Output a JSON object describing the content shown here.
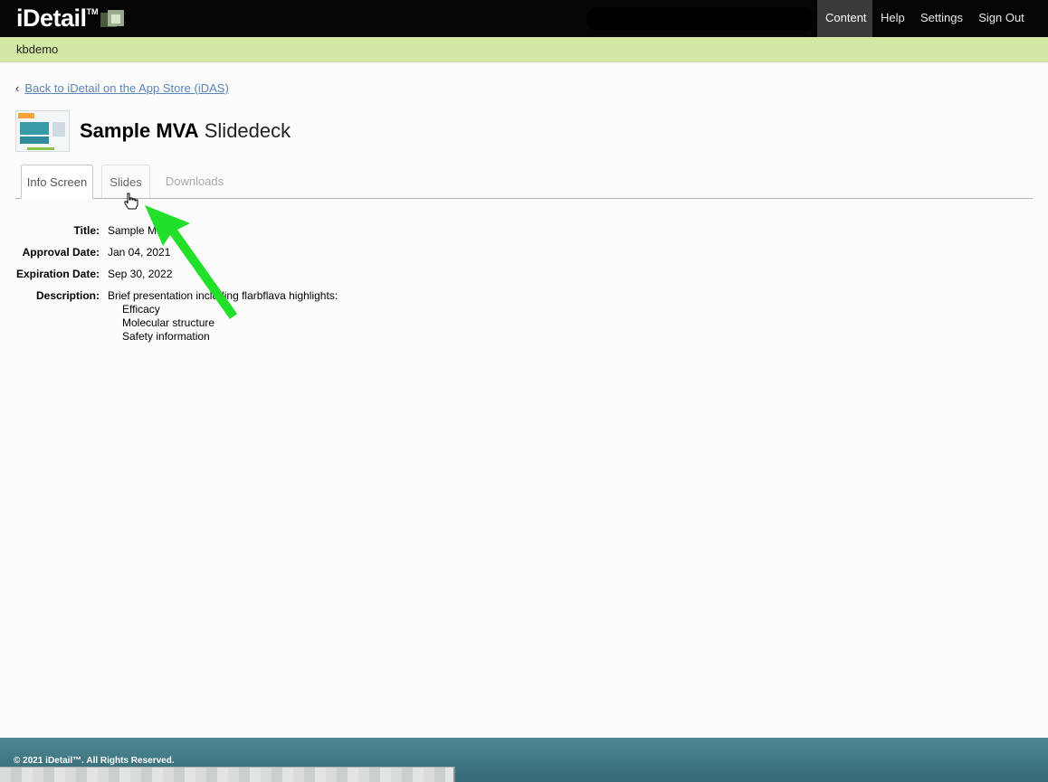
{
  "topbar": {
    "logo": "iDetail",
    "logo_tm": "TM",
    "nav": [
      {
        "label": "Content",
        "active": true
      },
      {
        "label": "Help",
        "active": false
      },
      {
        "label": "Settings",
        "active": false
      },
      {
        "label": "Sign Out",
        "active": false
      }
    ]
  },
  "userbar": {
    "username": "kbdemo"
  },
  "back": {
    "chevron": "‹",
    "label": "Back to iDetail on the App Store (iDAS)"
  },
  "header": {
    "title_bold": "Sample MVA",
    "title_light": "Slidedeck"
  },
  "tabs": [
    {
      "label": "Info Screen",
      "active": true
    },
    {
      "label": "Slides",
      "active": false
    },
    {
      "label": "Downloads",
      "disabled": true
    }
  ],
  "info": {
    "title_label": "Title:",
    "title_value": "Sample M",
    "approval_label": "Approval Date:",
    "approval_value": "Jan 04, 2021",
    "expiration_label": "Expiration Date:",
    "expiration_value": "Sep 30, 2022",
    "description_label": "Description:",
    "description_value": "Brief presentation including flarbflava highlights:",
    "description_items": [
      "Efficacy",
      "Molecular structure",
      "Safety information"
    ]
  },
  "footer": {
    "copyright": "© 2021 iDetail™.  All Rights Reserved."
  },
  "colors": {
    "topbar": "#050505",
    "userbar": "#d3e8a4",
    "link": "#5a86b8",
    "arrow": "#22e02a",
    "footer": "#3d7480"
  }
}
